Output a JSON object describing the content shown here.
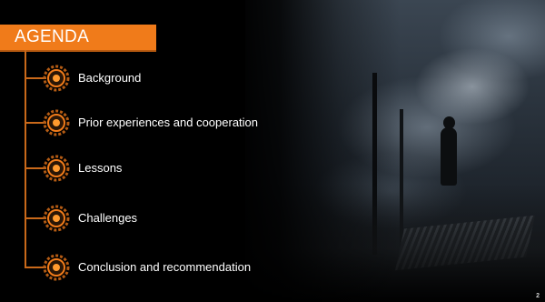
{
  "slide": {
    "title": "AGENDA",
    "accent_color": "#f07b1a",
    "line_color": "#c9691a",
    "page_number": "2",
    "items": [
      {
        "label": "Background",
        "icon": "gear-bullet-icon"
      },
      {
        "label": "Prior experiences and cooperation",
        "icon": "gear-bullet-icon"
      },
      {
        "label": "Lessons",
        "icon": "gear-bullet-icon"
      },
      {
        "label": "Challenges",
        "icon": "gear-bullet-icon"
      },
      {
        "label": "Conclusion and recommendation",
        "icon": "gear-bullet-icon"
      }
    ]
  }
}
